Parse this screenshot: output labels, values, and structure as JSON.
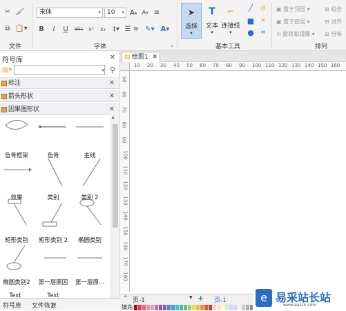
{
  "ribbon": {
    "font_name": "宋体",
    "font_size": "10",
    "font_size_up": "A",
    "font_size_down": "A",
    "group_file": "文件",
    "group_font": "字体",
    "group_tools": "基本工具",
    "group_arrange": "排列",
    "select_label": "选择",
    "text_label": "文本",
    "connector_label": "连接线",
    "bold": "B",
    "italic": "I",
    "underline": "U",
    "strike": "abc",
    "superscript": "x²",
    "subscript": "x₂",
    "font_color": "A",
    "bring_front": "置于顶层",
    "send_back": "置于底层",
    "rotate_mirror": "旋转和镜像",
    "group": "组合",
    "align": "对齐",
    "distribute": "分布"
  },
  "panel": {
    "title": "符号库",
    "categories": [
      "标注",
      "箭头形状",
      "因果图形状"
    ],
    "shapes": [
      {
        "label": "鱼骨框架"
      },
      {
        "label": "鱼骨"
      },
      {
        "label": "主线"
      },
      {
        "label": "效果"
      },
      {
        "label": "类别"
      },
      {
        "label": "类别 2"
      },
      {
        "label": "矩形类别"
      },
      {
        "label": "矩形类别 2"
      },
      {
        "label": "椭圆类别"
      },
      {
        "label": "椭圆类别2"
      },
      {
        "label": "第一层原因"
      },
      {
        "label": "第一层原..."
      },
      {
        "label": "Text"
      },
      {
        "label": "Text"
      },
      {
        "label": ""
      }
    ],
    "tabs": [
      "符号库",
      "文件恢复"
    ]
  },
  "document": {
    "tab_title": "绘图1",
    "ruler_h": [
      "10",
      "20",
      "30",
      "40",
      "50",
      "60",
      "70",
      "80",
      "90",
      "100",
      "110",
      "120",
      "130",
      "140",
      "150",
      "160"
    ],
    "ruler_v": [
      "50",
      "60",
      "70",
      "80",
      "90",
      "100",
      "110",
      "120",
      "130",
      "140",
      "150",
      "160",
      "170",
      "180"
    ],
    "page_tab_left": "页-1",
    "page_tab_right": "页-1",
    "fill_label": "填充"
  },
  "watermark": {
    "text": "易采站长站",
    "sub": "www.easck.com"
  },
  "colors": {
    "accent": "#2b6cc4",
    "category_icon": "#e6a24a",
    "ribbon_bg": "#f3f3f3"
  }
}
